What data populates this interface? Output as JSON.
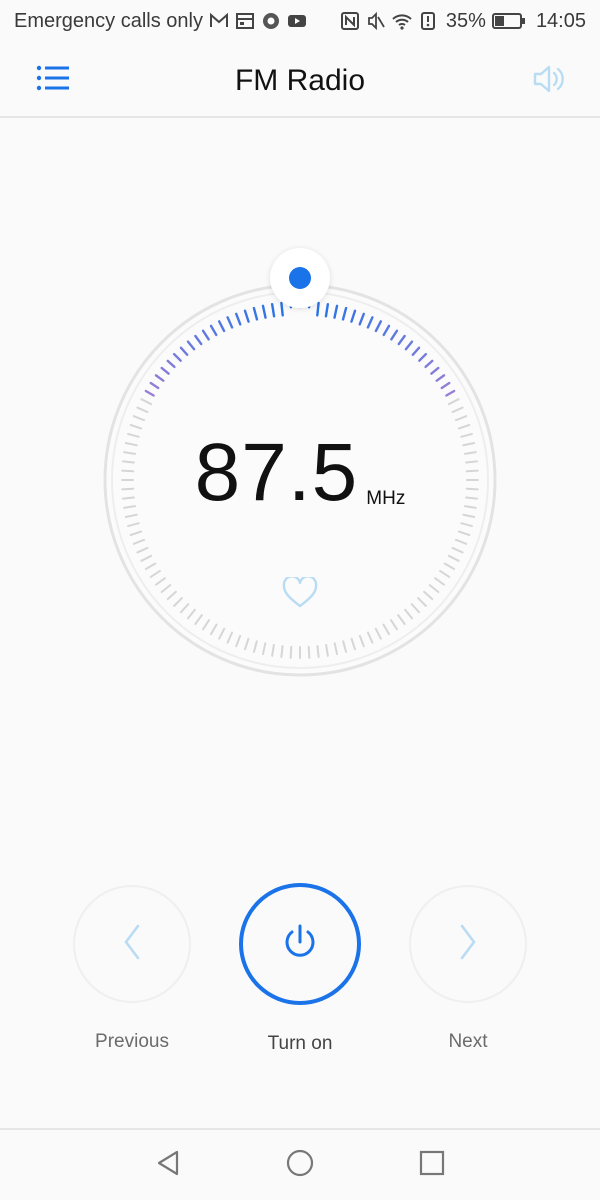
{
  "status_bar": {
    "carrier_text": "Emergency calls only",
    "battery_percent": "35%",
    "time": "14:05",
    "icons": [
      "gmail-icon",
      "calendar-icon",
      "chrome-icon",
      "youtube-icon",
      "nfc-icon",
      "mute-icon",
      "wifi-icon",
      "battery-alert-icon",
      "battery-icon"
    ]
  },
  "header": {
    "title": "FM Radio",
    "menu_icon": "list-menu-icon",
    "speaker_icon": "speaker-icon"
  },
  "tuner": {
    "frequency": "87.5",
    "unit": "MHz",
    "favorite_icon": "heart-icon",
    "accent_color": "#1a73e8",
    "scale_gradient": [
      "#9b7fd6",
      "#1a73e8"
    ]
  },
  "controls": {
    "previous_label": "Previous",
    "power_label": "Turn on",
    "next_label": "Next",
    "previous_icon": "chevron-left-icon",
    "power_icon": "power-icon",
    "next_icon": "chevron-right-icon"
  },
  "nav_bar": {
    "back_icon": "back-triangle-icon",
    "home_icon": "home-circle-icon",
    "recents_icon": "recents-square-icon"
  }
}
